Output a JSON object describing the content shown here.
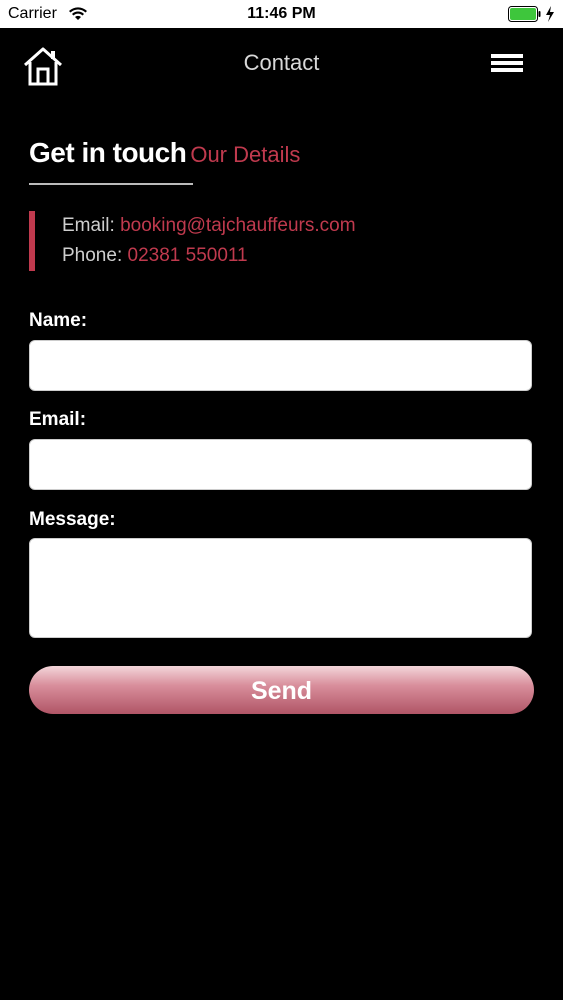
{
  "status_bar": {
    "carrier": "Carrier",
    "time": "11:46 PM",
    "battery_icon": "battery-full-icon",
    "wifi_icon": "wifi-icon"
  },
  "nav": {
    "title": "Contact",
    "home_icon": "home-icon",
    "menu_icon": "hamburger-menu-icon"
  },
  "heading": {
    "title": "Get in touch",
    "subtitle": "Our Details"
  },
  "details": {
    "email_label": "Email:",
    "email_value": "booking@tajchauffeurs.com",
    "phone_label": "Phone:",
    "phone_value": "02381 550011"
  },
  "form": {
    "name_label": "Name:",
    "name_value": "",
    "email_label": "Email:",
    "email_value": "",
    "message_label": "Message:",
    "message_value": "",
    "send_label": "Send"
  },
  "colors": {
    "accent": "#c03a4e",
    "background": "#000000",
    "field_background": "#ffffff"
  }
}
